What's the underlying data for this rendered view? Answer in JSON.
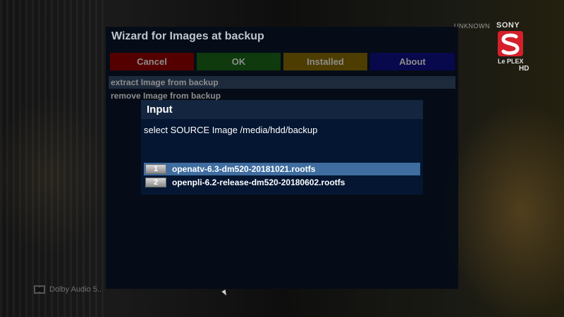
{
  "channel_logo": {
    "status": "UNKNOWN",
    "brand": "SONY",
    "channel": "Le PLEX",
    "quality": "HD",
    "colors": {
      "brand_red": "#d4202a",
      "text": "#e0e0e0"
    }
  },
  "audio_badge": {
    "label": "Dolby Audio 5.."
  },
  "wizard": {
    "title": "Wizard for Images at backup",
    "buttons": {
      "cancel": "Cancel",
      "ok": "OK",
      "installed": "Installed",
      "about": "About"
    },
    "button_colors": {
      "red": "#550000",
      "green": "#0e3a0e",
      "yellow": "#4d3d00",
      "blue": "#08084c"
    },
    "menu": [
      {
        "label": "extract Image from backup",
        "selected": true
      },
      {
        "label": "remove Image from backup",
        "selected": false
      }
    ]
  },
  "input_dialog": {
    "title": "Input",
    "prompt": "select SOURCE Image /media/hdd/backup",
    "items": [
      {
        "number": "1",
        "label": "openatv-6.3-dm520-20181021.rootfs",
        "selected": true
      },
      {
        "number": "2",
        "label": "openpli-6.2-release-dm520-20180602.rootfs",
        "selected": false
      }
    ],
    "colors": {
      "title_bg": "#14263f",
      "body_bg": "#041632",
      "selection": "#3f6d9f"
    }
  }
}
